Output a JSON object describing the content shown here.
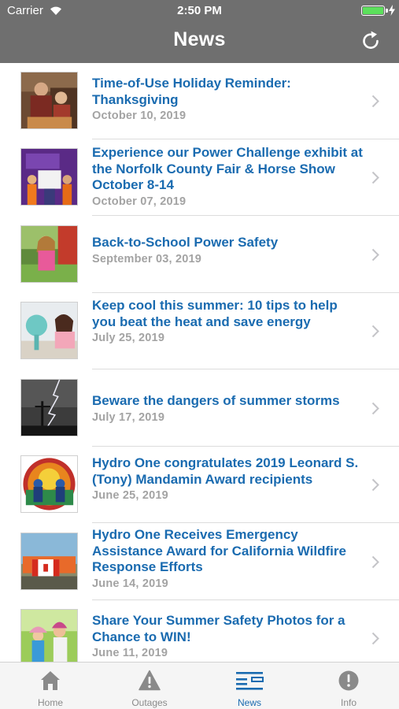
{
  "status_bar": {
    "carrier": "Carrier",
    "time": "2:50 PM",
    "battery_color": "#5ce05c"
  },
  "nav": {
    "title": "News",
    "refresh_icon": "refresh-icon"
  },
  "news": [
    {
      "title": "Time-of-Use Holiday Reminder: Thanksgiving",
      "date": "October 10, 2019"
    },
    {
      "title": "Experience our Power Challenge exhibit at the Norfolk County Fair & Horse Show October 8-14",
      "date": "October 07, 2019"
    },
    {
      "title": "Back-to-School Power Safety",
      "date": "September 03, 2019"
    },
    {
      "title": "Keep cool this summer: 10 tips to help you beat the heat and save energy",
      "date": "July 25, 2019"
    },
    {
      "title": "Beware the dangers of summer storms",
      "date": "July 17, 2019"
    },
    {
      "title": "Hydro One congratulates 2019 Leonard S. (Tony) Mandamin Award recipients",
      "date": "June 25, 2019"
    },
    {
      "title": "Hydro One Receives Emergency Assistance Award for California Wildfire Response Efforts",
      "date": "June 14, 2019"
    },
    {
      "title": "Share Your Summer Safety Photos for a Chance to WIN!",
      "date": "June 11, 2019"
    }
  ],
  "tabs": [
    {
      "label": "Home",
      "icon": "home-icon",
      "active": false
    },
    {
      "label": "Outages",
      "icon": "warning-icon",
      "active": false
    },
    {
      "label": "News",
      "icon": "news-icon",
      "active": true
    },
    {
      "label": "Info",
      "icon": "info-icon",
      "active": false
    }
  ],
  "colors": {
    "header_bg": "#6f6f6f",
    "accent": "#1a6bb0",
    "date_text": "#a3a3a3",
    "inactive_tab": "#8a8a8a"
  }
}
